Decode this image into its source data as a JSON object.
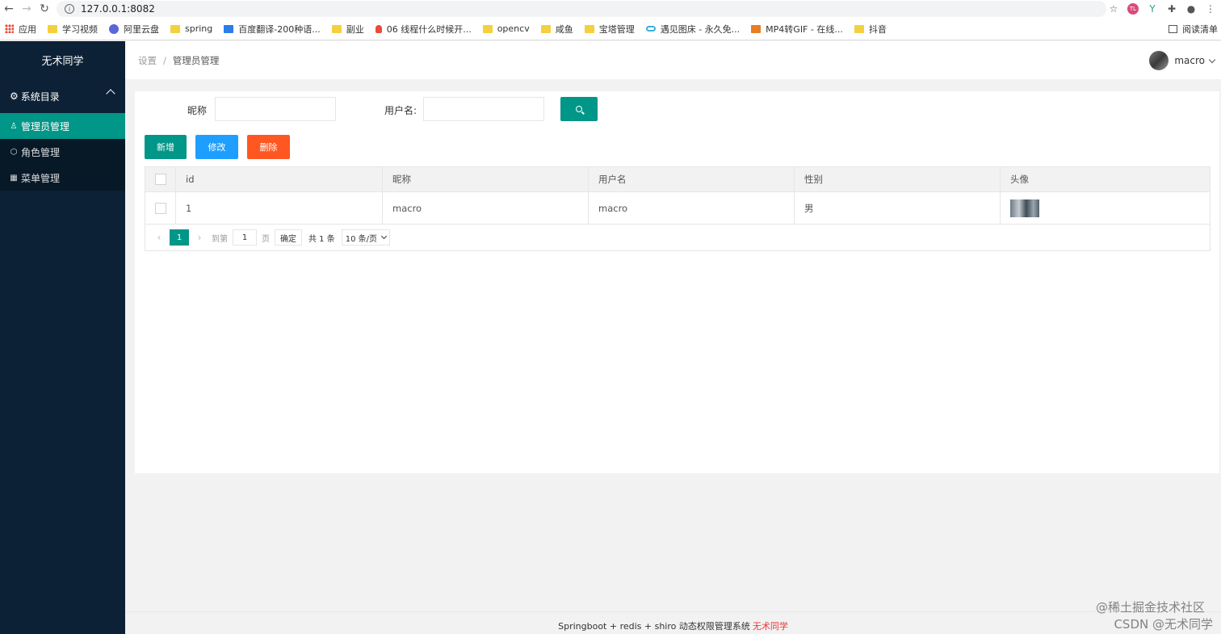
{
  "browser": {
    "url": "127.0.0.1:8082",
    "bookmarks": [
      {
        "label": "应用",
        "icon": "apps-icon"
      },
      {
        "label": "学习视频",
        "icon": "folder-icon"
      },
      {
        "label": "阿里云盘",
        "icon": "aliyun-drive-icon"
      },
      {
        "label": "spring",
        "icon": "folder-icon"
      },
      {
        "label": "百度翻译-200种语...",
        "icon": "baidu-translate-icon"
      },
      {
        "label": "副业",
        "icon": "folder-icon"
      },
      {
        "label": "06 线程什么时候开...",
        "icon": "flame-icon"
      },
      {
        "label": "opencv",
        "icon": "folder-icon"
      },
      {
        "label": "咸鱼",
        "icon": "folder-icon"
      },
      {
        "label": "宝塔管理",
        "icon": "folder-icon"
      },
      {
        "label": "遇见图床 - 永久免...",
        "icon": "link-icon"
      },
      {
        "label": "MP4转GIF - 在线...",
        "icon": "convert-icon"
      },
      {
        "label": "抖音",
        "icon": "folder-icon"
      }
    ],
    "reading_list": "阅读清单"
  },
  "sidebar": {
    "logo": "无术同学",
    "group": "系统目录",
    "items": [
      {
        "label": "管理员管理",
        "icon": "user-icon",
        "active": true
      },
      {
        "label": "角色管理",
        "icon": "cube-icon",
        "active": false
      },
      {
        "label": "菜单管理",
        "icon": "menu-grid-icon",
        "active": false
      }
    ]
  },
  "header": {
    "breadcrumb": [
      "设置",
      "管理员管理"
    ],
    "separator": "/",
    "user_name": "macro"
  },
  "search": {
    "nickname_label": "昵称",
    "username_label": "用户名:",
    "nickname_value": "",
    "username_value": ""
  },
  "toolbar": {
    "add_label": "新增",
    "edit_label": "修改",
    "delete_label": "删除"
  },
  "table": {
    "columns": [
      "id",
      "昵称",
      "用户名",
      "性别",
      "头像"
    ],
    "rows": [
      {
        "id": "1",
        "nickname": "macro",
        "username": "macro",
        "gender": "男"
      }
    ]
  },
  "pagination": {
    "current_page": "1",
    "goto_label": "到第",
    "goto_value": "1",
    "page_unit": "页",
    "confirm_label": "确定",
    "total_text": "共 1 条",
    "page_size": "10 条/页"
  },
  "footer": {
    "text": "Springboot + redis + shiro 动态权限管理系统",
    "author": "无术同学"
  },
  "watermark": {
    "line1": "@稀土掘金技术社区",
    "line2": "CSDN @无术同学"
  },
  "colors": {
    "primary": "#009688",
    "blue": "#1e9fff",
    "orange": "#ff5722",
    "sidebar_bg": "#0c2135"
  }
}
